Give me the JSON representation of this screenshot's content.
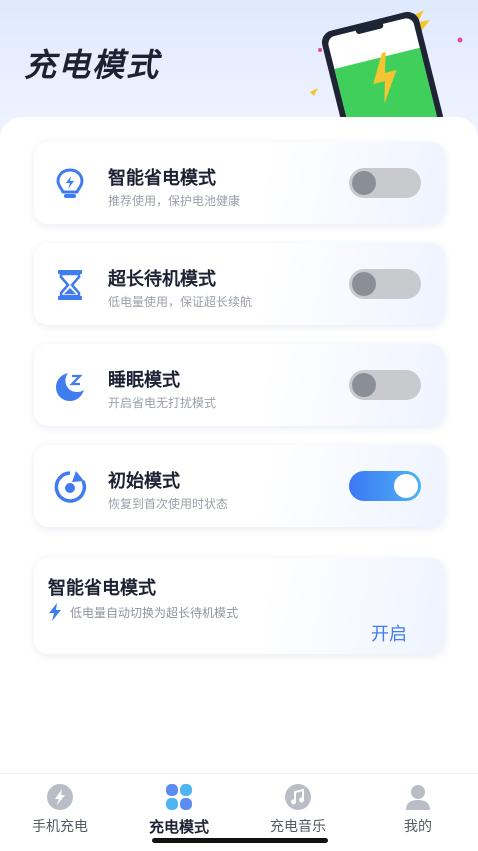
{
  "header": {
    "title": "充电模式"
  },
  "modes": [
    {
      "title": "智能省电模式",
      "subtitle": "推荐使用，保护电池健康",
      "icon": "lightbulb-icon",
      "enabled": false
    },
    {
      "title": "超长待机模式",
      "subtitle": "低电量使用，保证超长续航",
      "icon": "hourglass-icon",
      "enabled": false
    },
    {
      "title": "睡眠模式",
      "subtitle": "开启省电无打扰模式",
      "icon": "moon-sleep-icon",
      "enabled": false
    },
    {
      "title": "初始模式",
      "subtitle": "恢复到首次使用时状态",
      "icon": "restore-icon",
      "enabled": true
    }
  ],
  "smart_card": {
    "title": "智能省电模式",
    "description": "低电量自动切换为超长待机模式",
    "action": "开启",
    "icon": "bolt-icon"
  },
  "tabs": [
    {
      "label": "手机充电",
      "icon": "bolt-circle-icon",
      "active": false
    },
    {
      "label": "充电模式",
      "icon": "grid-icon",
      "active": true
    },
    {
      "label": "充电音乐",
      "icon": "music-note-icon",
      "active": false
    },
    {
      "label": "我的",
      "icon": "user-icon",
      "active": false
    }
  ],
  "colors": {
    "accent": "#3f7cf0",
    "toggle_off": "#c9cacd",
    "toggle_on_start": "#3b78f5",
    "toggle_on_end": "#4fb2f3",
    "phone_green": "#3fcf5a",
    "bolt_yellow": "#f5c531"
  }
}
